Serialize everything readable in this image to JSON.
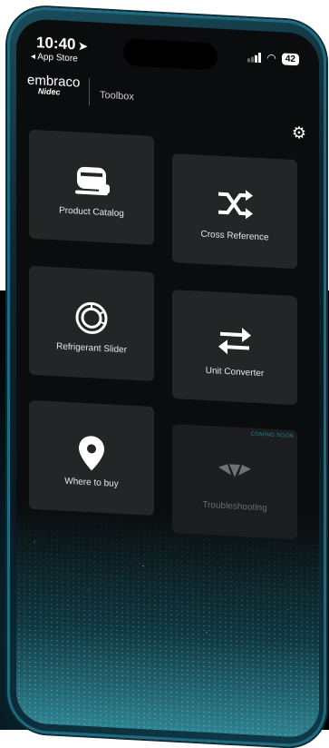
{
  "status": {
    "time": "10:40",
    "back_label": "◂ App Store",
    "battery": "42"
  },
  "header": {
    "brand": "embraco",
    "brand_sub": "Nidec",
    "title": "Toolbox"
  },
  "tiles": [
    {
      "label": "Product Catalog",
      "icon": "compressor-icon"
    },
    {
      "label": "Cross Reference",
      "icon": "shuffle-icon"
    },
    {
      "label": "Refrigerant Slider",
      "icon": "slider-dial-icon"
    },
    {
      "label": "Unit Converter",
      "icon": "swap-arrows-icon"
    },
    {
      "label": "Where to buy",
      "icon": "location-pin-icon"
    },
    {
      "label": "Troubleshooting",
      "icon": "fan-icon",
      "badge": "COMING SOON",
      "disabled": true
    }
  ],
  "colors": {
    "screen_bg": "#0b0c0d",
    "tile_bg": "#232526",
    "accent": "#2b7f90"
  }
}
